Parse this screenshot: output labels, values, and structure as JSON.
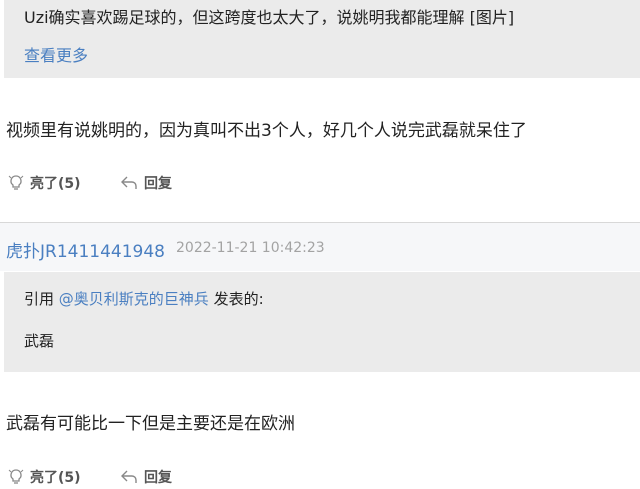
{
  "post1": {
    "quote": {
      "text": "Uzi确实喜欢踢足球的，但这跨度也太大了，说姚明我都能理解 [图片]",
      "more": "查看更多"
    },
    "body": "视频里有说姚明的，因为真叫不出3个人，好几个人说完武磊就呆住了",
    "actions": {
      "like": "亮了(5)",
      "reply": "回复"
    }
  },
  "post2": {
    "username": "虎扑JR1411441948",
    "timestamp": "2022-11-21 10:42:23",
    "quote": {
      "prefix": "引用 ",
      "author": "@奥贝利斯克的巨神兵",
      "suffix": " 发表的:",
      "text": "武磊"
    },
    "body": "武磊有可能比一下但是主要还是在欧洲",
    "actions": {
      "like": "亮了(5)",
      "reply": "回复"
    }
  },
  "icons": {
    "like": "lightbulb-icon",
    "reply": "reply-arrow-icon"
  },
  "colors": {
    "link": "#4a7fc1",
    "quote_bg": "#ebebeb",
    "header_bg": "#f6f7f9"
  }
}
